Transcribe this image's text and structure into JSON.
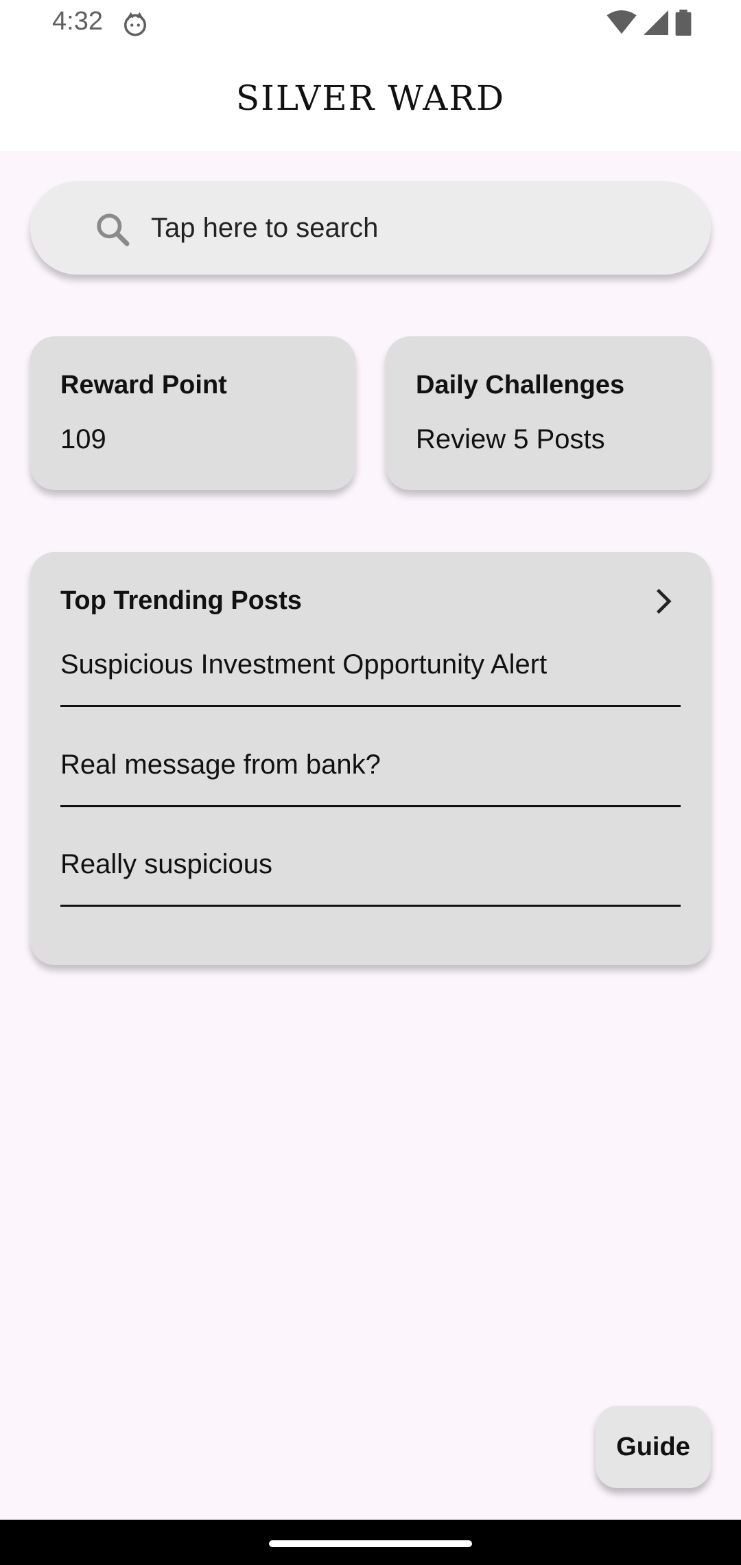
{
  "status_bar": {
    "time": "4:32"
  },
  "app_bar": {
    "title": "SILVER WARD"
  },
  "search": {
    "placeholder": "Tap here to search",
    "icon": "search-icon"
  },
  "reward_card": {
    "title": "Reward Point",
    "value": "109"
  },
  "challenge_card": {
    "title": "Daily Challenges",
    "value": "Review 5 Posts"
  },
  "trending": {
    "title": "Top Trending Posts",
    "posts": [
      {
        "title": "Suspicious Investment Opportunity Alert"
      },
      {
        "title": "Real message from bank?"
      },
      {
        "title": "Really suspicious"
      }
    ]
  },
  "guide_button": {
    "label": "Guide"
  },
  "colors": {
    "background": "#fcf5fc",
    "card": "#dedede",
    "search": "#ececec"
  }
}
